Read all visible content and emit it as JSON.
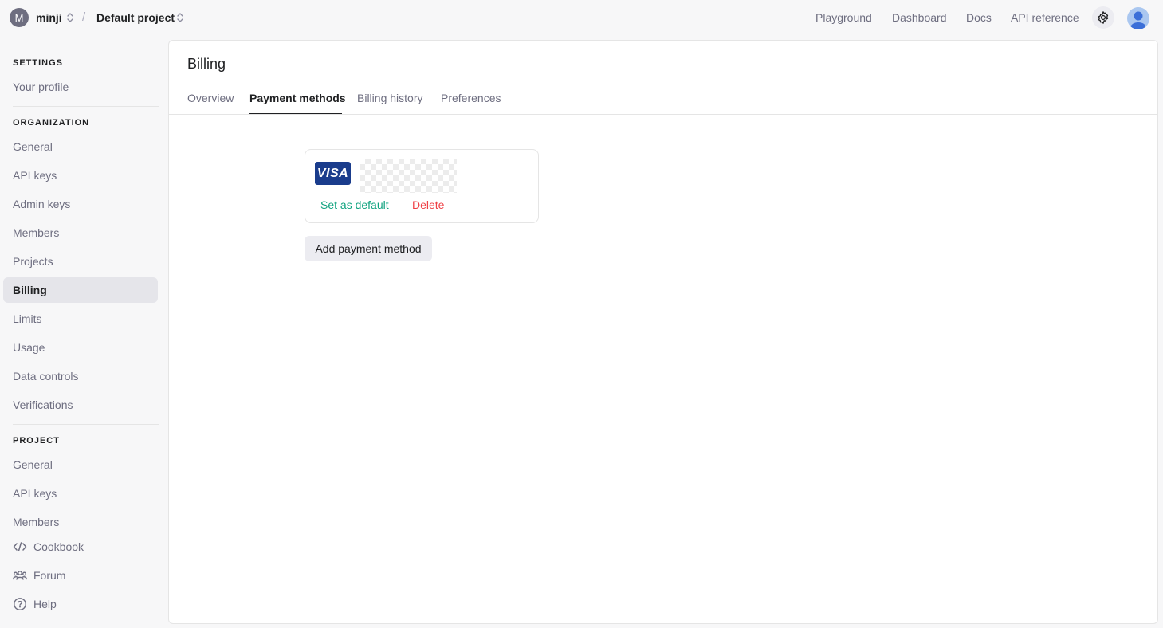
{
  "topbar": {
    "org_initial": "M",
    "org_name": "minji",
    "separator": "/",
    "project_name": "Default project",
    "nav": [
      "Playground",
      "Dashboard",
      "Docs",
      "API reference"
    ],
    "settings_icon": "gear-icon",
    "avatar_icon": "user-avatar-icon"
  },
  "sidebar": {
    "settings_heading": "SETTINGS",
    "settings_items": [
      "Your profile"
    ],
    "org_heading": "ORGANIZATION",
    "org_items": [
      "General",
      "API keys",
      "Admin keys",
      "Members",
      "Projects",
      "Billing",
      "Limits",
      "Usage",
      "Data controls",
      "Verifications"
    ],
    "active_item": "Billing",
    "project_heading": "PROJECT",
    "project_items": [
      "General",
      "API keys",
      "Members"
    ],
    "footer": [
      {
        "label": "Cookbook",
        "icon": "code-icon"
      },
      {
        "label": "Forum",
        "icon": "people-icon"
      },
      {
        "label": "Help",
        "icon": "help-circle-icon"
      }
    ]
  },
  "main": {
    "title": "Billing",
    "tabs": [
      "Overview",
      "Payment methods",
      "Billing history",
      "Preferences"
    ],
    "active_tab": "Payment methods",
    "card": {
      "brand": "VISA",
      "set_default_label": "Set as default",
      "delete_label": "Delete"
    },
    "add_button_label": "Add payment method"
  },
  "colors": {
    "accent_green": "#10a37f",
    "danger_red": "#ef4146",
    "visa_blue": "#1a3c8c"
  }
}
